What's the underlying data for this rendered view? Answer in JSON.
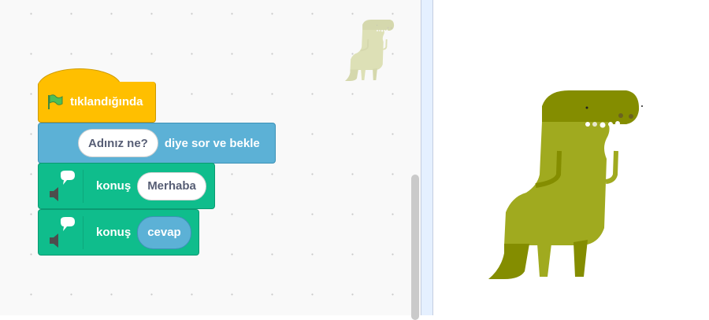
{
  "script": {
    "hat_block": {
      "icon": "green-flag-icon",
      "label": "tıklandığında"
    },
    "ask_block": {
      "input": "Adınız ne?",
      "label": "diye sor ve bekle"
    },
    "say_blocks": [
      {
        "icon": "speech-speaker-icon",
        "label": "konuş",
        "input": "Merhaba"
      },
      {
        "icon": "speech-speaker-icon",
        "label": "konuş",
        "input": "cevap"
      }
    ]
  },
  "colors": {
    "events": "#ffbf00",
    "sensing": "#5cb1d6",
    "looks_ext": "#0fbd8c",
    "dino_light": "#a0aa1f",
    "dino_dark": "#848d00"
  }
}
